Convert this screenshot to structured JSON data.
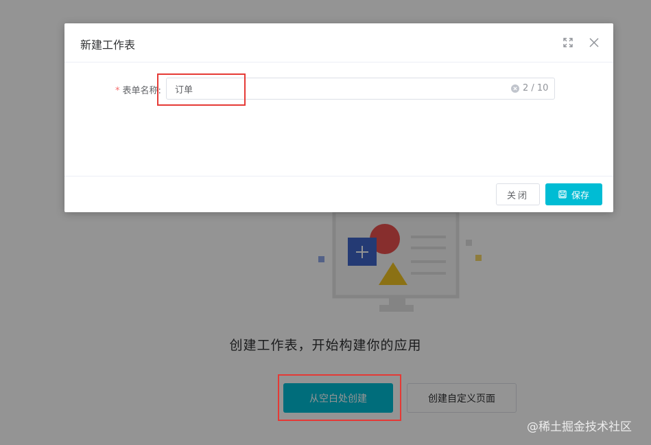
{
  "background": {
    "empty_text": "创建工作表，开始构建你的应用",
    "create_blank_label": "从空白处创建",
    "create_custom_page_label": "创建自定义页面"
  },
  "dialog": {
    "title": "新建工作表",
    "field_required_mark": "*",
    "field_label": "表单名称:",
    "field_value": "订单",
    "field_counter": "2 / 10",
    "close_label": "关闭",
    "save_label": "保存"
  },
  "watermark": "@稀土掘金技术社区",
  "icons": {
    "fullscreen": "fullscreen-icon",
    "close": "close-icon",
    "clear": "clear-icon",
    "save": "save-icon"
  },
  "colors": {
    "accent": "#00bcd4",
    "highlight": "#e53935",
    "required": "#f56c6c"
  }
}
